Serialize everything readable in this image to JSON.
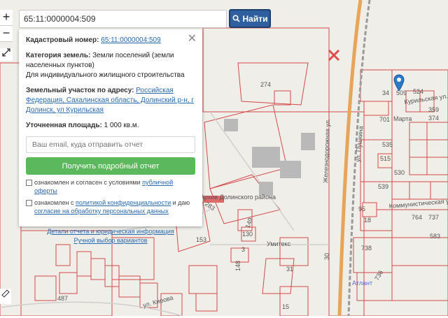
{
  "search": {
    "value": "65:11:0000004:509"
  },
  "find_button": {
    "label": "Найти"
  },
  "zoom": {
    "in_label": "+",
    "out_label": "−"
  },
  "popup": {
    "cadastral_label": "Кадастровый номер:",
    "cadastral_value": "65:11:0000004:509",
    "category_label": "Категория земель:",
    "category_value": "Земли поселений (земли населенных пунктов)",
    "purpose": "Для индивидуального жилищного строительства",
    "address_label": "Земельный участок по адресу:",
    "address_value": "Российская Федерация, Сахалинская область, Долинский р-н, г Долинск, ул Курильская",
    "area_label": "Уточненная площадь:",
    "area_value": "1 000 кв.м.",
    "email_placeholder": "Ваш email, куда отправить отчет",
    "get_report_button": "Получить подробный отчет",
    "consent1_text": "ознакомлен и согласен с условиями",
    "consent1_link": "публичной оферты",
    "consent2_text": "ознакомлен с",
    "consent2_link1": "политикой конфиденциальности",
    "consent2_mid": "и даю",
    "consent2_link2": "согласие на обработку персональных данных",
    "details_link": "Детали отчета и юридическая информация",
    "manual_link": "Ручной выбор вариантов"
  },
  "map": {
    "labels": {
      "l274": "274",
      "l509": "509",
      "l34": "34",
      "l524": "524",
      "l359": "359",
      "l374": "374",
      "marta": "Марта",
      "l701": "701",
      "l535": "535",
      "l515": "515",
      "l530": "530",
      "l95": "95",
      "l738": "738",
      "l764": "764",
      "l737": "737",
      "l583": "583",
      "l130": "130",
      "l149": "149",
      "l153": "153",
      "l31": "31",
      "l30": "30",
      "l15": "15",
      "l3": "3",
      "l148": "148",
      "l487": "487",
      "l283": "283",
      "l18": "18",
      "l718": "718",
      "l539": "539",
      "l736": "736",
      "archive": "Архив Долинского района",
      "umitex": "Умитекс",
      "atlant": "Атлант",
      "kirova": "ул. Кирова",
      "pushkina": "ул. Пушкина",
      "zheleznodorozhnaya": "Железнодорожная ул.",
      "kurilskaya": "Курильская ул.",
      "kommunisticheskaya": "Коммунистическая ул."
    },
    "colors": {
      "parcel_line": "#d24a4a",
      "railway": "#9a9a9a",
      "road": "#e8a55a"
    }
  }
}
